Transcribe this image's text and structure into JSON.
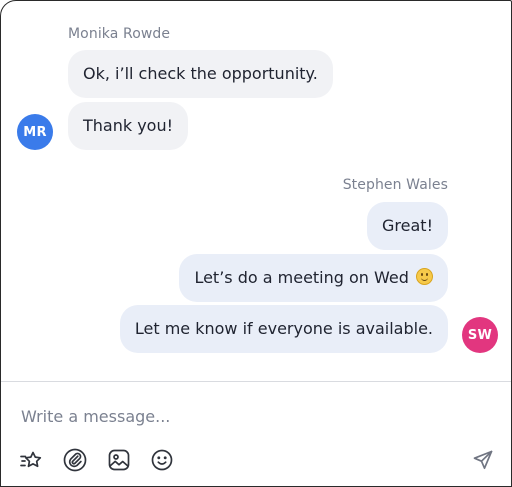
{
  "thread": {
    "incoming": {
      "sender_name": "Monika Rowde",
      "avatar_initials": "MR",
      "avatar_color": "#3a7bea",
      "messages": [
        "Ok, i’ll check the opportunity.",
        "Thank you!"
      ]
    },
    "outgoing": {
      "sender_name": "Stephen Wales",
      "avatar_initials": "SW",
      "avatar_color": "#e2367f",
      "messages": [
        "Great!",
        "Let’s do a meeting on Wed",
        "Let me know if everyone is available."
      ],
      "emoji_in_message_2": "slightly-smiling-face"
    }
  },
  "composer": {
    "placeholder": "Write a message...",
    "value": "",
    "toolbar": [
      {
        "icon": "sparkle-star-icon"
      },
      {
        "icon": "attachment-icon"
      },
      {
        "icon": "image-icon"
      },
      {
        "icon": "emoji-icon"
      }
    ],
    "send_icon": "send-icon"
  },
  "colors": {
    "incoming_bubble": "#f1f2f5",
    "outgoing_bubble": "#e9eef8",
    "text": "#202431",
    "muted": "#7b8190",
    "icon": "#30343c"
  }
}
